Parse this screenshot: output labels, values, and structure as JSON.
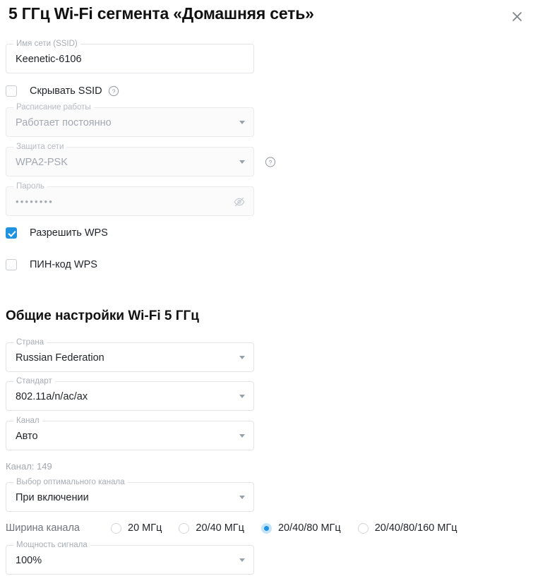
{
  "header": {
    "title": "5 ГГц Wi-Fi сегмента «Домашняя сеть»",
    "close_label": "✕"
  },
  "segment": {
    "ssid_field": {
      "label": "Имя сети (SSID)",
      "value": "Keenetic-6106"
    },
    "hide_ssid": {
      "label": "Скрывать SSID",
      "checked": false,
      "help": "?"
    },
    "schedule_field": {
      "label": "Расписание работы",
      "value": "Работает постоянно"
    },
    "security_field": {
      "label": "Защита сети",
      "value": "WPA2-PSK",
      "help": "?"
    },
    "password_field": {
      "label": "Пароль",
      "value": "••••••••"
    },
    "allow_wps": {
      "label": "Разрешить WPS",
      "checked": true
    },
    "wps_pin": {
      "label": "ПИН-код WPS",
      "checked": false
    }
  },
  "general": {
    "title": "Общие настройки Wi-Fi 5 ГГц",
    "country_field": {
      "label": "Страна",
      "value": "Russian Federation"
    },
    "standard_field": {
      "label": "Стандарт",
      "value": "802.11a/n/ac/ax"
    },
    "channel_field": {
      "label": "Канал",
      "value": "Авто"
    },
    "channel_hint": "Канал: 149",
    "optimal_channel_field": {
      "label": "Выбор оптимального канала",
      "value": "При включении"
    },
    "channel_width": {
      "label": "Ширина канала",
      "options": [
        {
          "label": "20 МГц",
          "selected": false
        },
        {
          "label": "20/40 МГц",
          "selected": false
        },
        {
          "label": "20/40/80 МГц",
          "selected": true
        },
        {
          "label": "20/40/80/160 МГц",
          "selected": false
        }
      ]
    },
    "power_field": {
      "label": "Мощность сигнала",
      "value": "100%"
    }
  },
  "colors": {
    "accent": "#1f93e0",
    "accent_soft": "#c3e4f8",
    "text": "#1f2328",
    "muted": "#a2a8b0",
    "border": "#e2e4e7"
  }
}
